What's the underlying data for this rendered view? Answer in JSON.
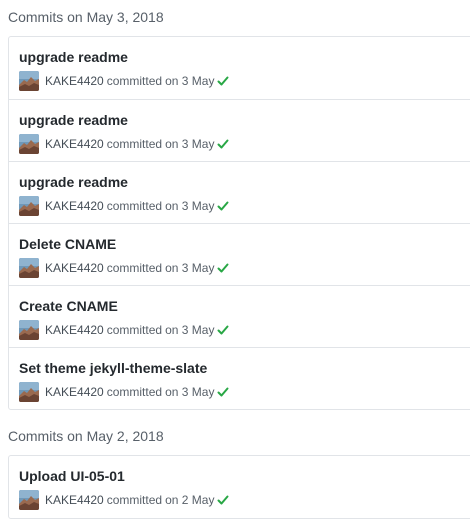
{
  "groups": [
    {
      "title": "Commits on May 3, 2018",
      "commits": [
        {
          "message": "upgrade readme",
          "author": "KAKE4420",
          "action": "committed",
          "date": "on 3 May"
        },
        {
          "message": "upgrade readme",
          "author": "KAKE4420",
          "action": "committed",
          "date": "on 3 May"
        },
        {
          "message": "upgrade readme",
          "author": "KAKE4420",
          "action": "committed",
          "date": "on 3 May"
        },
        {
          "message": "Delete CNAME",
          "author": "KAKE4420",
          "action": "committed",
          "date": "on 3 May"
        },
        {
          "message": "Create CNAME",
          "author": "KAKE4420",
          "action": "committed",
          "date": "on 3 May"
        },
        {
          "message": "Set theme jekyll-theme-slate",
          "author": "KAKE4420",
          "action": "committed",
          "date": "on 3 May"
        }
      ]
    },
    {
      "title": "Commits on May 2, 2018",
      "commits": [
        {
          "message": "Upload UI-05-01",
          "author": "KAKE4420",
          "action": "committed",
          "date": "on 2 May"
        }
      ]
    }
  ],
  "icons": {
    "status": "check-icon",
    "avatar": "avatar-image"
  },
  "colors": {
    "status_success": "#28a745",
    "border": "#e1e4e8",
    "muted_text": "#586069"
  }
}
